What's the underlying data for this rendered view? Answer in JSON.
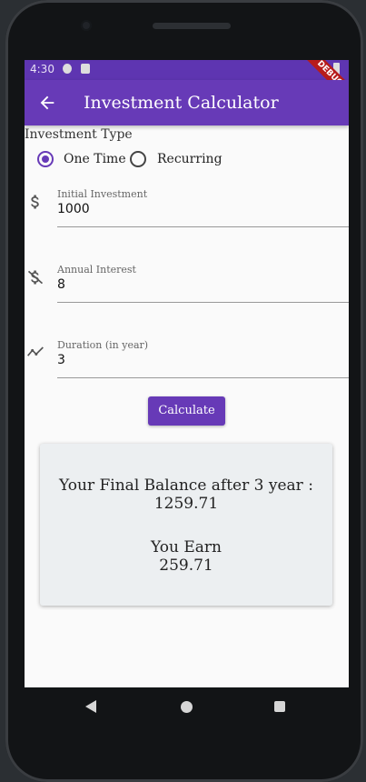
{
  "status_bar": {
    "time": "4:30",
    "debug_label": "DEBUG"
  },
  "app_bar": {
    "title": "Investment Calculator",
    "back_icon": "arrow-back-icon"
  },
  "investment_type": {
    "label": "Investment Type",
    "options": [
      {
        "label": "One Time",
        "selected": true
      },
      {
        "label": "Recurring",
        "selected": false
      }
    ]
  },
  "fields": {
    "initial_investment": {
      "label": "Initial Investment",
      "value": "1000",
      "icon": "dollar-icon"
    },
    "annual_interest": {
      "label": "Annual Interest",
      "value": "8",
      "icon": "money-off-icon"
    },
    "duration": {
      "label": "Duration (in year)",
      "value": "3",
      "icon": "trending-icon"
    }
  },
  "calculate_button": "Calculate",
  "result": {
    "final_balance_label": "Your Final Balance after 3 year :",
    "final_balance_value": "1259.71",
    "earn_label": "You Earn",
    "earn_value": "259.71"
  },
  "colors": {
    "primary": "#673ab7",
    "status_bar": "#5e35b1",
    "card_bg": "#eceff1"
  }
}
